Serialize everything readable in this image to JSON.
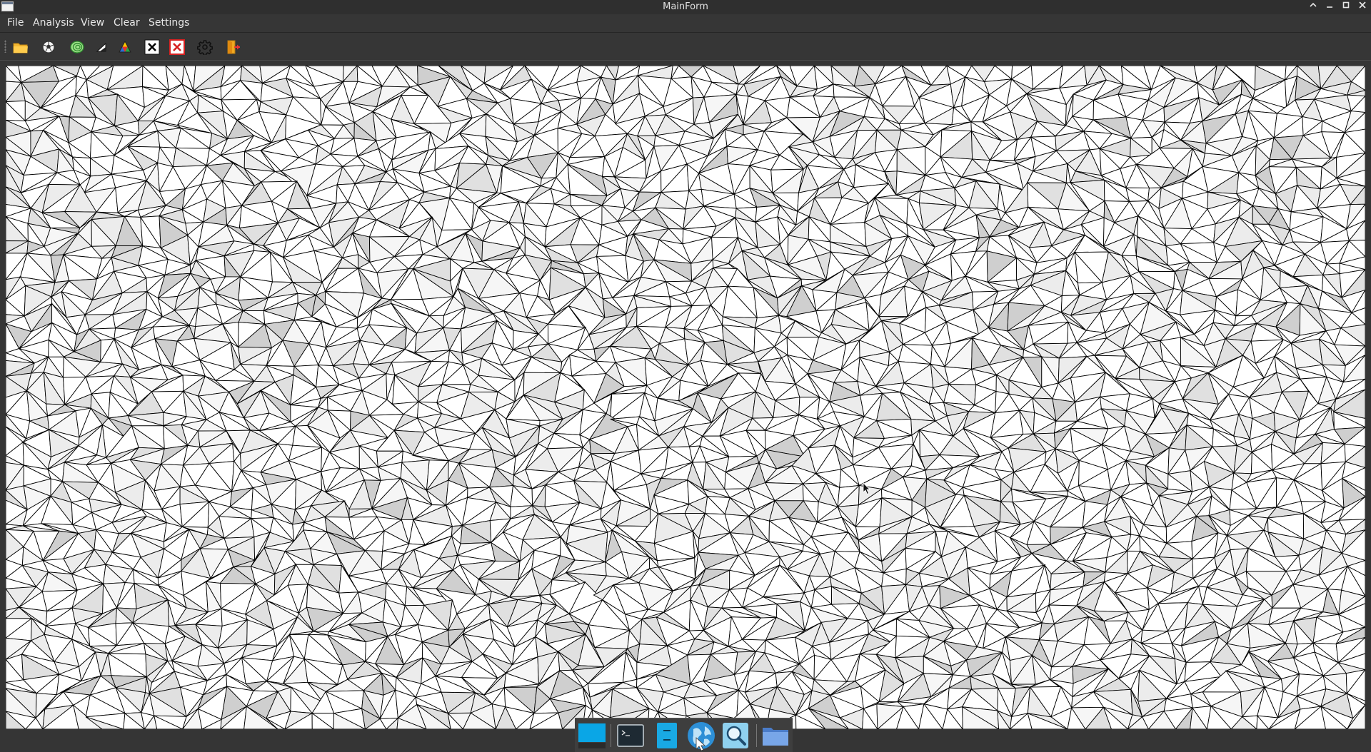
{
  "window": {
    "title": "MainForm"
  },
  "menu": {
    "items": [
      "File",
      "Analysis",
      "View",
      "Clear",
      "Settings"
    ]
  },
  "toolbar": {
    "buttons": [
      {
        "icon": "open-folder-icon"
      },
      {
        "icon": "soccer-ball-icon"
      },
      {
        "icon": "contour-rings-icon"
      },
      {
        "icon": "triangle-icon"
      },
      {
        "icon": "color-triangle-icon"
      },
      {
        "icon": "clear-box-icon"
      },
      {
        "icon": "clear-red-box-icon"
      },
      {
        "icon": "gear-icon"
      },
      {
        "icon": "exit-door-icon"
      }
    ]
  },
  "canvas": {
    "content": "triangulated-mesh",
    "colors": {
      "background": "#ffffff",
      "edges": "#000000",
      "shade_light": "#f4f4f4",
      "shade_dark": "#cfcfcf"
    }
  },
  "taskbar": {
    "items": [
      {
        "icon": "show-desktop-icon"
      },
      {
        "icon": "terminal-icon"
      },
      {
        "icon": "file-manager-panel-icon"
      },
      {
        "icon": "web-browser-globe-icon"
      },
      {
        "icon": "search-magnifier-icon"
      },
      {
        "icon": "folder-icon"
      }
    ]
  }
}
